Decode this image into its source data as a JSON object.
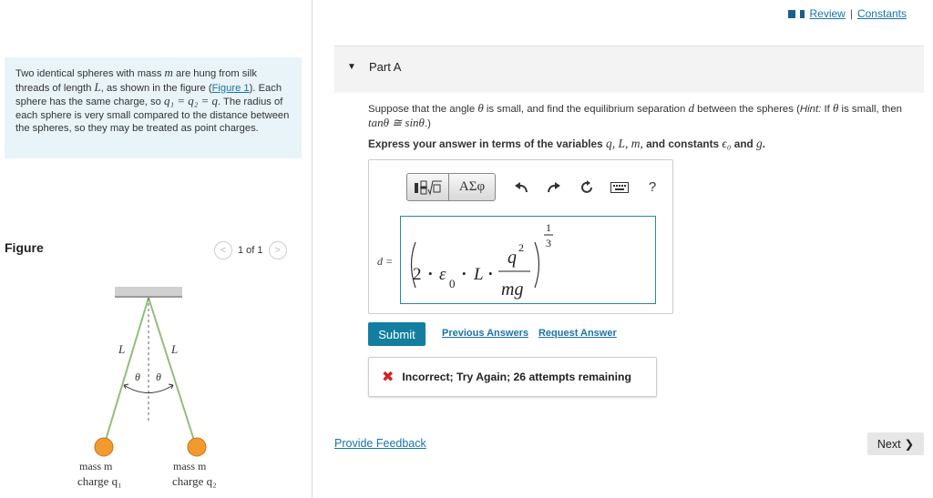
{
  "header": {
    "review_label": "Review",
    "separator": "|",
    "constants_label": "Constants"
  },
  "problem": {
    "text_1": "Two identical spheres with mass ",
    "mass_var": "m",
    "text_2": " are hung from silk threads of length ",
    "length_var": "L",
    "text_3": ", as shown in the figure (",
    "figure_link": "Figure 1",
    "text_4": "). Each sphere has the same charge, so ",
    "charge_eq": "q₁ = q₂ = q",
    "text_5": ". The radius of each sphere is very small compared to the distance between the spheres, so they may be treated as point charges."
  },
  "figure_panel": {
    "title": "Figure",
    "pager_text": "1 of 1",
    "prev_arrow": "<",
    "next_arrow": ">",
    "labels": {
      "L_left": "L",
      "L_right": "L",
      "theta_left": "θ",
      "theta_right": "θ",
      "mass_left": "mass m",
      "mass_right": "mass m",
      "charge_left": "charge q₁",
      "charge_right": "charge q₂"
    },
    "colors": {
      "thread": "#8fbf7a",
      "sphere": "#f29a2e",
      "ceiling": "#cccccc"
    }
  },
  "part": {
    "title": "Part A",
    "question_1": "Suppose that the angle ",
    "theta": "θ",
    "question_2": " is small, and find the equilibrium separation ",
    "d_var": "d",
    "question_3": " between the spheres (",
    "hint_label": "Hint:",
    "question_4": " If ",
    "question_5": " is small, then ",
    "approx": "tanθ ≅ sinθ",
    "question_6": ".)",
    "instruction_1": "Express your answer in terms of the variables ",
    "vars": "q, L, m,",
    "instruction_2": " and constants ",
    "consts": "ϵ₀",
    "instruction_3": " and ",
    "g_var": "g",
    "instruction_4": "."
  },
  "answer": {
    "toolbar": {
      "template_icon": "template-radical-icon",
      "greek_label": "ΑΣφ",
      "undo_icon": "undo-icon",
      "redo_icon": "redo-icon",
      "reset_icon": "reset-icon",
      "keyboard_icon": "keyboard-icon",
      "help_label": "?"
    },
    "lhs": "d =",
    "expression": {
      "coef": "2",
      "dot": "•",
      "eps": "ε",
      "eps_sub": "0",
      "L": "L",
      "numerator": "q",
      "num_exp": "2",
      "denominator": "mg",
      "outer_exp_num": "1",
      "outer_exp_den": "3"
    }
  },
  "actions": {
    "submit_label": "Submit",
    "previous_answers": "Previous Answers",
    "request_answer": "Request Answer"
  },
  "feedback": {
    "icon": "✖",
    "message": "Incorrect; Try Again; 26 attempts remaining"
  },
  "footer": {
    "provide_feedback": "Provide Feedback",
    "next_label": "Next",
    "next_arrow": "❯"
  }
}
